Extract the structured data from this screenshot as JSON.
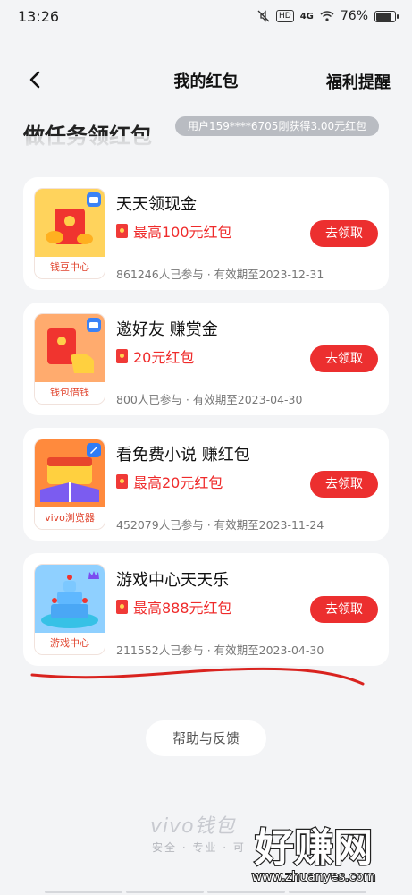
{
  "status_bar": {
    "time": "13:26",
    "icons": [
      "mute-icon",
      "hd-icon",
      "signal-4g-icon",
      "wifi-icon",
      "battery-icon"
    ],
    "hd_label": "HD",
    "network_label": "4G",
    "battery": "76%"
  },
  "nav": {
    "title": "我的红包",
    "right_action": "福利提醒"
  },
  "section": {
    "title": "做任务领红包",
    "notice": "用户159****6705刚获得3.00元红包"
  },
  "tasks": [
    {
      "title": "天天领现金",
      "reward": "最高100元红包",
      "button": "去领取",
      "meta": "861246人已参与 · 有效期至2023-12-31",
      "app_label": "钱豆中心",
      "icon": "red-envelope-coins-icon"
    },
    {
      "title": "邀好友 赚赏金",
      "reward": "20元红包",
      "button": "去领取",
      "meta": "800人已参与 · 有效期至2023-04-30",
      "app_label": "钱包借钱",
      "icon": "hand-red-envelope-icon"
    },
    {
      "title": "看免费小说 赚红包",
      "reward": "最高20元红包",
      "button": "去领取",
      "meta": "452079人已参与 · 有效期至2023-11-24",
      "app_label": "vivo浏览器",
      "icon": "treasure-book-icon"
    },
    {
      "title": "游戏中心天天乐",
      "reward": "最高888元红包",
      "button": "去领取",
      "meta": "211552人已参与 · 有效期至2023-04-30",
      "app_label": "游戏中心",
      "icon": "game-fountain-icon"
    }
  ],
  "help_button": "帮助与反馈",
  "footer": {
    "brand": "vivo钱包",
    "tagline": "安全 · 专业 · 可"
  },
  "watermark": {
    "text": "好赚网",
    "url": "www.zhuanyes.com"
  },
  "colors": {
    "accent": "#ec2f2f",
    "background": "#f3f4f6"
  }
}
